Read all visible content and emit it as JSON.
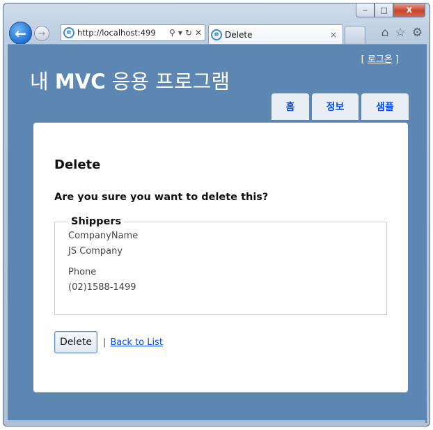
{
  "browser": {
    "address_url": "http://localhost:499",
    "tab_title": "Delete",
    "tab_close": "×",
    "caption": {
      "minimize": "‒",
      "maximize": "□",
      "close": "x"
    },
    "address_tools": [
      "⚲",
      "▾",
      "↻",
      "✕"
    ],
    "right_icons": [
      "home-icon",
      "star-icon",
      "gear-icon"
    ]
  },
  "header": {
    "login_open": "[ ",
    "login_label": "로그온",
    "login_close": " ]",
    "title_prefix": "내 ",
    "title_bold": "MVC",
    "title_suffix": " 응용 프로그램"
  },
  "menu": {
    "home": "홈",
    "about": "정보",
    "sample": "샘플"
  },
  "main": {
    "heading": "Delete",
    "confirm": "Are you sure you want to delete this?",
    "fieldset_legend": "Shippers",
    "fields": [
      {
        "label": "CompanyName",
        "value": "JS Company"
      },
      {
        "label": "Phone",
        "value": "(02)1588-1499"
      }
    ],
    "delete_button": "Delete",
    "separator": "|",
    "back_link": "Back to List"
  },
  "colors": {
    "page_background": "#5c87b2",
    "content_background": "#ffffff",
    "link": "#034af3",
    "menu_tab": "#e8eef4"
  }
}
